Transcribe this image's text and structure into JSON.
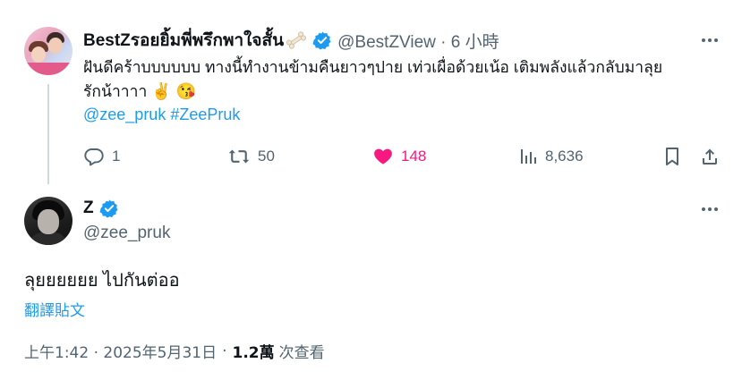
{
  "parent_tweet": {
    "author_name": "BestZรอยยิ้มพี่พรึกพาใจสั้น",
    "author_handle_meta": "@BestZView · 6 小時",
    "text": "ฝันดีคร้าบบบบบบ ทางนี้ทำงานข้ามคืนยาวๆปาย เท่วเผื่อด้วยเน้อ เติมพลังแล้วกลับมาลุย",
    "text_line2": "รักน้าาาา",
    "emojis": "✌️ 😘",
    "mention": "@zee_pruk",
    "hashtag": "#ZeePruk",
    "stats": {
      "replies": "1",
      "retweets": "50",
      "likes": "148",
      "views": "8,636"
    }
  },
  "reply_tweet": {
    "author_name": "Z",
    "author_handle": "@zee_pruk",
    "text": "ลุยยยยยย ไปกันต่ออ",
    "translate_label": "翻譯貼文",
    "timestamp": "上午1:42 · 2025年5月31日",
    "separator": "·",
    "views_count": "1.2萬",
    "views_label": "次查看"
  },
  "icons": {
    "verified": "verified-badge-icon",
    "bone": "bone-emoji-icon",
    "reply": "reply-icon",
    "retweet": "retweet-icon",
    "like": "heart-icon",
    "views": "views-icon",
    "bookmark": "bookmark-icon",
    "share": "share-icon",
    "more": "more-icon"
  },
  "colors": {
    "accent": "#1d9bf0",
    "like": "#f91880",
    "muted": "#536471",
    "text": "#0f1419"
  }
}
